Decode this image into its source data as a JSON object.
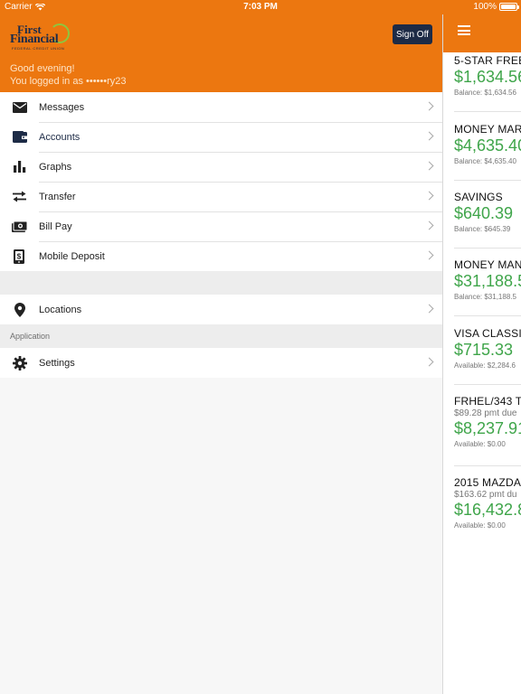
{
  "status_bar": {
    "carrier": "Carrier",
    "time": "7:03 PM",
    "battery": "100%"
  },
  "header": {
    "logo": {
      "line1": "First",
      "line2": "Financial",
      "line3": "FEDERAL CREDIT UNION"
    },
    "sign_off_label": "Sign Off",
    "greeting": "Good evening!",
    "logged_in": "You logged in as ••••••ry23"
  },
  "menu": {
    "items": [
      {
        "label": "Messages",
        "icon": "envelope-icon"
      },
      {
        "label": "Accounts",
        "icon": "wallet-icon"
      },
      {
        "label": "Graphs",
        "icon": "bar-chart-icon"
      },
      {
        "label": "Transfer",
        "icon": "transfer-arrows-icon"
      },
      {
        "label": "Bill Pay",
        "icon": "money-bill-icon"
      },
      {
        "label": "Mobile Deposit",
        "icon": "mobile-deposit-icon"
      }
    ],
    "locations_label": "Locations",
    "application_section": "Application",
    "settings_label": "Settings"
  },
  "accounts": [
    {
      "name": "5-STAR FREE",
      "amount": "$1,634.56",
      "sub": "Balance: $1,634.56"
    },
    {
      "name": "MONEY MARK",
      "amount": "$4,635.40",
      "sub": "Balance: $4,635.40"
    },
    {
      "name": "SAVINGS",
      "amount": "$640.39",
      "sub": "Balance: $645.39"
    },
    {
      "name": "MONEY MANA",
      "amount": "$31,188.5",
      "sub": "Balance: $31,188.5"
    },
    {
      "name": "VISA CLASSIC",
      "amount": "$715.33",
      "sub": "Available: $2,284.6"
    },
    {
      "name": "FRHEL/343 TI",
      "due": "$89.28 pmt due",
      "amount": "$8,237.91",
      "sub": "Available: $0.00"
    },
    {
      "name": "2015 MAZDA C",
      "due": "$163.62 pmt du",
      "amount": "$16,432.8",
      "sub": "Available: $0.00"
    }
  ],
  "colors": {
    "brand_orange": "#ec7710",
    "navy": "#1d2b46",
    "amount_green": "#3fa54a"
  }
}
